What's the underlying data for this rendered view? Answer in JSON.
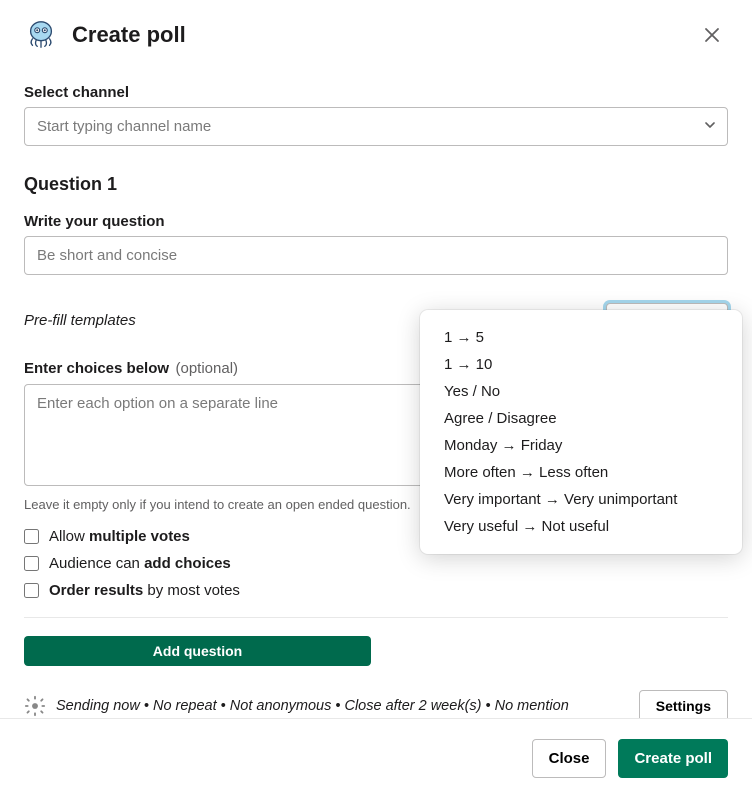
{
  "header": {
    "title": "Create poll"
  },
  "channel": {
    "label": "Select channel",
    "placeholder": "Start typing channel name"
  },
  "question": {
    "heading": "Question 1",
    "label": "Write your question",
    "placeholder": "Be short and concise"
  },
  "prefill": {
    "label": "Pre-fill templates",
    "options": [
      "1 → 5",
      "1 → 10",
      "Yes / No",
      "Agree / Disagree",
      "Monday → Friday",
      "More often → Less often",
      "Very important → Very unimportant",
      "Very useful → Not useful"
    ]
  },
  "choices": {
    "label": "Enter choices below",
    "optional": "(optional)",
    "placeholder": "Enter each option on a separate line",
    "hint": "Leave it empty only if you intend to create an open ended question."
  },
  "checkboxes": {
    "allow_pre": "Allow ",
    "allow_bold": "multiple votes",
    "audience_pre": "Audience can ",
    "audience_bold": "add choices",
    "order_bold": "Order results",
    "order_post": " by most votes"
  },
  "add_question": "Add question",
  "status": {
    "text": "Sending now • No repeat • Not anonymous • Close after 2 week(s) • No mention",
    "settings": "Settings"
  },
  "footer": {
    "close": "Close",
    "create": "Create poll"
  }
}
